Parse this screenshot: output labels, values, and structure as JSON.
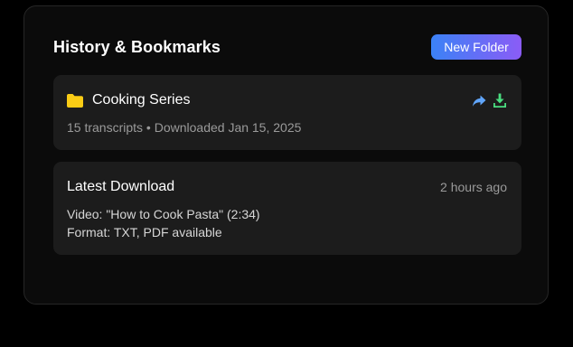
{
  "panel": {
    "title": "History & Bookmarks",
    "new_folder_label": "New Folder"
  },
  "folder_card": {
    "icon": "folder-icon",
    "name": "Cooking Series",
    "meta": "15 transcripts • Downloaded Jan 15, 2025",
    "actions": [
      "share-icon",
      "download-icon"
    ]
  },
  "latest_card": {
    "title": "Latest Download",
    "time": "2 hours ago",
    "video": "Video: \"How to Cook Pasta\" (2:34)",
    "format": "Format: TXT, PDF available"
  },
  "colors": {
    "background": "#000000",
    "panel": "#0b0b0b",
    "card": "#1c1c1c",
    "folder_icon": "#facc15",
    "share_icon": "#60a5fa",
    "download_icon": "#4ade80",
    "button_gradient_start": "#3b82f6",
    "button_gradient_end": "#8b5cf6"
  }
}
